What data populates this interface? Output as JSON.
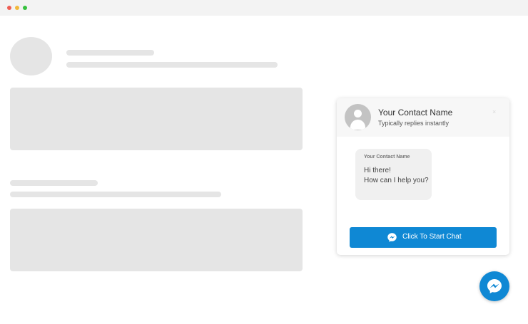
{
  "widget": {
    "contact_name": "Your Contact Name",
    "status": "Typically replies instantly",
    "close_glyph": "×",
    "message": {
      "sender": "Your Contact Name",
      "line1": "Hi there!",
      "line2": "How can I help you?"
    },
    "button_label": "Click To Start Chat"
  },
  "icons": {
    "window_controls": [
      "close-dot",
      "minimize-dot",
      "maximize-dot"
    ],
    "avatar": "person-icon",
    "button": "messenger-icon",
    "launcher": "messenger-icon"
  },
  "colors": {
    "accent": "#0f88d4",
    "placeholder": "#e5e5e5",
    "header_bg": "#f7f7f7",
    "bubble_bg": "#f0f0f0"
  }
}
